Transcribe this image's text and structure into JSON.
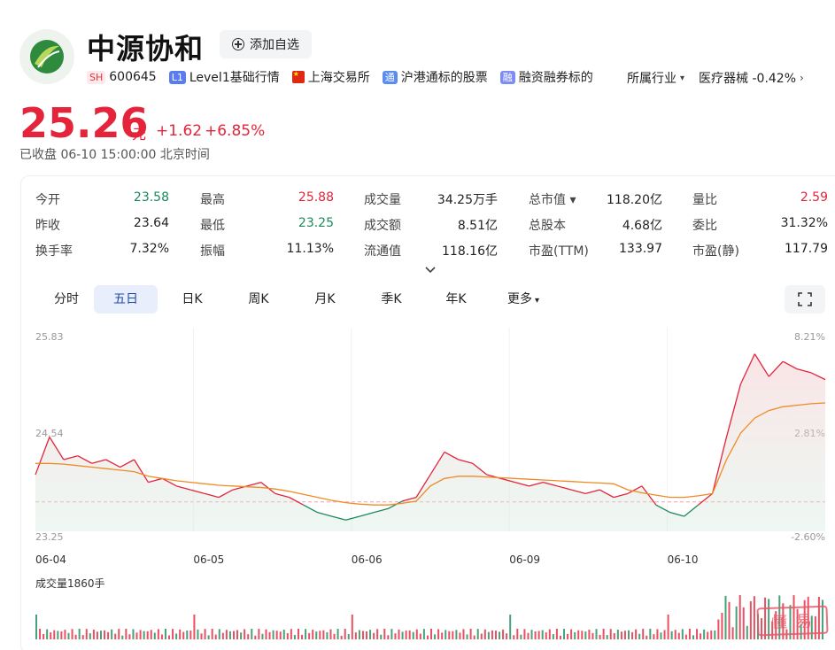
{
  "header": {
    "name": "中源协和",
    "add_watchlist": "添加自选",
    "market_badge": "SH",
    "code": "600645",
    "level_badge": "L1",
    "level_label": "Level1基础行情",
    "exchange": "上海交易所",
    "connect_badge": "通",
    "connect_label": "沪港通标的股票",
    "margin_badge": "融",
    "margin_label": "融资融券标的",
    "industry_label": "所属行业",
    "industry_value": "医疗器械 -0.42%"
  },
  "quote": {
    "price": "25.26",
    "unit": "元",
    "change": "+1.62",
    "change_pct": "+6.85%",
    "status": "已收盘  06-10 15:00:00 北京时间"
  },
  "stats": [
    {
      "label": "今开",
      "value": "23.58",
      "color": "green"
    },
    {
      "label": "最高",
      "value": "25.88",
      "color": "red"
    },
    {
      "label": "成交量",
      "value": "34.25万手",
      "color": ""
    },
    {
      "label": "总市值 ▾",
      "value": "118.20亿",
      "color": ""
    },
    {
      "label": "量比",
      "value": "2.59",
      "color": "red"
    },
    {
      "label": "昨收",
      "value": "23.64",
      "color": ""
    },
    {
      "label": "最低",
      "value": "23.25",
      "color": "green"
    },
    {
      "label": "成交额",
      "value": "8.51亿",
      "color": ""
    },
    {
      "label": "总股本",
      "value": "4.68亿",
      "color": ""
    },
    {
      "label": "委比",
      "value": "31.32%",
      "color": ""
    },
    {
      "label": "换手率",
      "value": "7.32%",
      "color": ""
    },
    {
      "label": "振幅",
      "value": "11.13%",
      "color": ""
    },
    {
      "label": "流通值",
      "value": "118.16亿",
      "color": ""
    },
    {
      "label": "市盈(TTM)",
      "value": "133.97",
      "color": ""
    },
    {
      "label": "市盈(静)",
      "value": "117.79",
      "color": ""
    }
  ],
  "tabs": [
    "分时",
    "五日",
    "日K",
    "周K",
    "月K",
    "季K",
    "年K",
    "更多"
  ],
  "active_tab": "五日",
  "colors": {
    "up": "#e3243b",
    "down": "#1a8a5a",
    "avg": "#f08a24",
    "accent": "#1f4aa8"
  },
  "chart_data": {
    "type": "line",
    "y_ticks_left": [
      "25.83",
      "24.54",
      "23.25"
    ],
    "y_ticks_right": [
      "8.21%",
      "2.81%",
      "-2.60%"
    ],
    "x": [
      "06-04",
      "06-05",
      "06-06",
      "06-09",
      "06-10"
    ],
    "ylim": [
      23.25,
      25.83
    ],
    "prev_close": 23.64,
    "series": [
      {
        "values": [
          24.0,
          24.5,
          24.2,
          24.25,
          24.15,
          24.2,
          24.1,
          24.2,
          23.9,
          23.95,
          23.85,
          23.8,
          23.75,
          23.7,
          23.8,
          23.85,
          23.9,
          23.75,
          23.7,
          23.6,
          23.5,
          23.45,
          23.4,
          23.45,
          23.5,
          23.55,
          23.65,
          23.7,
          24.0,
          24.3,
          24.2,
          24.15,
          24.0,
          23.95,
          23.9,
          23.85,
          23.9,
          23.85,
          23.8,
          23.75,
          23.8,
          23.7,
          23.75,
          23.85,
          23.6,
          23.5,
          23.45,
          23.6,
          23.75,
          24.5,
          25.2,
          25.6,
          25.3,
          25.5,
          25.4,
          25.35,
          25.26
        ]
      },
      {
        "values": [
          24.15,
          24.15,
          24.14,
          24.12,
          24.1,
          24.08,
          24.06,
          24.04,
          23.98,
          23.95,
          23.92,
          23.9,
          23.88,
          23.86,
          23.85,
          23.84,
          23.83,
          23.81,
          23.78,
          23.74,
          23.7,
          23.66,
          23.63,
          23.61,
          23.6,
          23.6,
          23.62,
          23.65,
          23.85,
          23.95,
          23.98,
          23.98,
          23.97,
          23.96,
          23.95,
          23.94,
          23.93,
          23.92,
          23.91,
          23.9,
          23.89,
          23.88,
          23.8,
          23.76,
          23.73,
          23.7,
          23.7,
          23.72,
          23.75,
          24.2,
          24.55,
          24.75,
          24.85,
          24.9,
          24.92,
          24.94,
          24.95
        ]
      }
    ],
    "volume_label": "成交量1860手"
  }
}
